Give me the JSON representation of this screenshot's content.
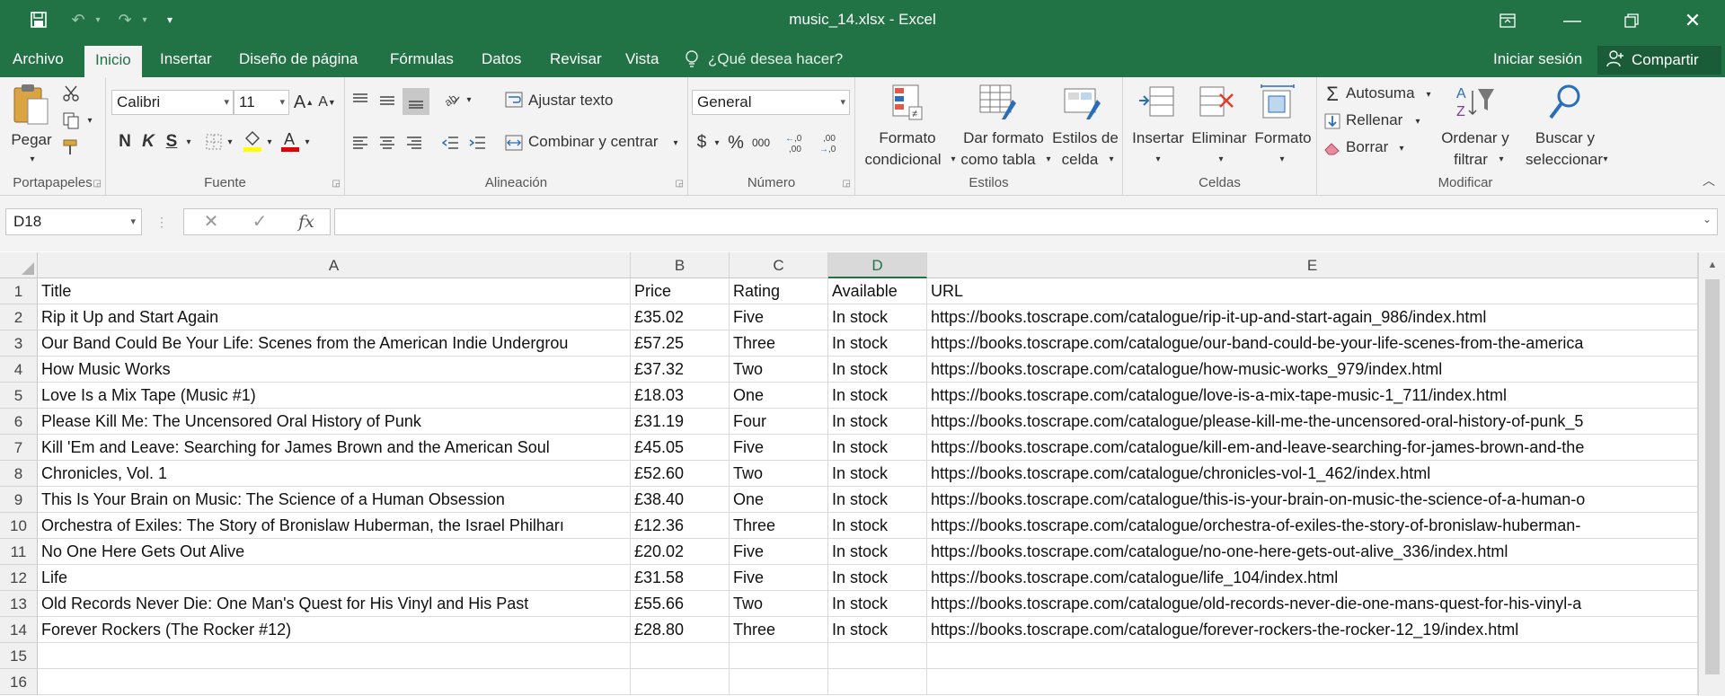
{
  "window": {
    "title": "music_14.xlsx - Excel",
    "minimize": "—",
    "restore": "❐",
    "close": "✕",
    "ribbon_display": "⧉"
  },
  "qat": {
    "save": "💾",
    "undo": "↶",
    "redo": "↷",
    "customize": "▾"
  },
  "tabs": [
    {
      "label": "Archivo"
    },
    {
      "label": "Inicio",
      "active": true
    },
    {
      "label": "Insertar"
    },
    {
      "label": "Diseño de página"
    },
    {
      "label": "Fórmulas"
    },
    {
      "label": "Datos"
    },
    {
      "label": "Revisar"
    },
    {
      "label": "Vista"
    }
  ],
  "tell_me": "¿Qué desea hacer?",
  "sign_in": "Iniciar sesión",
  "share": "Compartir",
  "ribbon": {
    "clipboard": {
      "label": "Portapapeles",
      "paste": "Pegar"
    },
    "font": {
      "label": "Fuente",
      "name": "Calibri",
      "size": "11",
      "grow": "A",
      "shrink": "A",
      "bold": "N",
      "italic": "K",
      "underline": "S"
    },
    "alignment": {
      "label": "Alineación",
      "wrap": "Ajustar texto",
      "merge": "Combinar y centrar"
    },
    "number": {
      "label": "Número",
      "format": "General",
      "currency": "$",
      "percent": "%",
      "thousands": "000",
      "inc_dec": "←,0 ,00",
      "dec_dec": ",00 →,0"
    },
    "styles": {
      "label": "Estilos",
      "conditional_1": "Formato",
      "conditional_2": "condicional",
      "table_1": "Dar formato",
      "table_2": "como tabla",
      "cell_1": "Estilos de",
      "cell_2": "celda"
    },
    "cells": {
      "label": "Celdas",
      "insert": "Insertar",
      "delete": "Eliminar",
      "format": "Formato"
    },
    "editing": {
      "label": "Modificar",
      "autosum": "Autosuma",
      "fill": "Rellenar",
      "clear": "Borrar",
      "sort_1": "Ordenar y",
      "sort_2": "filtrar",
      "find_1": "Buscar y",
      "find_2": "seleccionar"
    }
  },
  "formula_bar": {
    "name_box": "D18",
    "fx": "fx",
    "cancel": "✕",
    "enter": "✓",
    "value": ""
  },
  "grid": {
    "columns": [
      "A",
      "B",
      "C",
      "D",
      "E"
    ],
    "selected_column": "D",
    "row_numbers": [
      "1",
      "2",
      "3",
      "4",
      "5",
      "6",
      "7",
      "8",
      "9",
      "10",
      "11",
      "12",
      "13",
      "14",
      "15",
      "16"
    ],
    "header": [
      "Title",
      "Price",
      "Rating",
      "Available",
      "URL"
    ],
    "rows": [
      [
        "Rip it Up and Start Again",
        "£35.02",
        "Five",
        "In stock",
        "https://books.toscrape.com/catalogue/rip-it-up-and-start-again_986/index.html"
      ],
      [
        "Our Band Could Be Your Life: Scenes from the American Indie Undergrou",
        "£57.25",
        "Three",
        "In stock",
        "https://books.toscrape.com/catalogue/our-band-could-be-your-life-scenes-from-the-america"
      ],
      [
        "How Music Works",
        "£37.32",
        "Two",
        "In stock",
        "https://books.toscrape.com/catalogue/how-music-works_979/index.html"
      ],
      [
        "Love Is a Mix Tape (Music #1)",
        "£18.03",
        "One",
        "In stock",
        "https://books.toscrape.com/catalogue/love-is-a-mix-tape-music-1_711/index.html"
      ],
      [
        "Please Kill Me: The Uncensored Oral History of Punk",
        "£31.19",
        "Four",
        "In stock",
        "https://books.toscrape.com/catalogue/please-kill-me-the-uncensored-oral-history-of-punk_5"
      ],
      [
        "Kill 'Em and Leave: Searching for James Brown and the American Soul",
        "£45.05",
        "Five",
        "In stock",
        "https://books.toscrape.com/catalogue/kill-em-and-leave-searching-for-james-brown-and-the"
      ],
      [
        "Chronicles, Vol. 1",
        "£52.60",
        "Two",
        "In stock",
        "https://books.toscrape.com/catalogue/chronicles-vol-1_462/index.html"
      ],
      [
        "This Is Your Brain on Music: The Science of a Human Obsession",
        "£38.40",
        "One",
        "In stock",
        "https://books.toscrape.com/catalogue/this-is-your-brain-on-music-the-science-of-a-human-o"
      ],
      [
        "Orchestra of Exiles: The Story of Bronislaw Huberman, the Israel Philharı",
        "£12.36",
        "Three",
        "In stock",
        "https://books.toscrape.com/catalogue/orchestra-of-exiles-the-story-of-bronislaw-huberman-"
      ],
      [
        "No One Here Gets Out Alive",
        "£20.02",
        "Five",
        "In stock",
        "https://books.toscrape.com/catalogue/no-one-here-gets-out-alive_336/index.html"
      ],
      [
        "Life",
        "£31.58",
        "Five",
        "In stock",
        "https://books.toscrape.com/catalogue/life_104/index.html"
      ],
      [
        "Old Records Never Die: One Man's Quest for His Vinyl and His Past",
        "£55.66",
        "Two",
        "In stock",
        "https://books.toscrape.com/catalogue/old-records-never-die-one-mans-quest-for-his-vinyl-a"
      ],
      [
        "Forever Rockers (The Rocker #12)",
        "£28.80",
        "Three",
        "In stock",
        "https://books.toscrape.com/catalogue/forever-rockers-the-rocker-12_19/index.html"
      ]
    ]
  },
  "colors": {
    "accent": "#217346",
    "accent_dark": "#1a5c38",
    "ribbon_bg": "#f3f3f3"
  }
}
